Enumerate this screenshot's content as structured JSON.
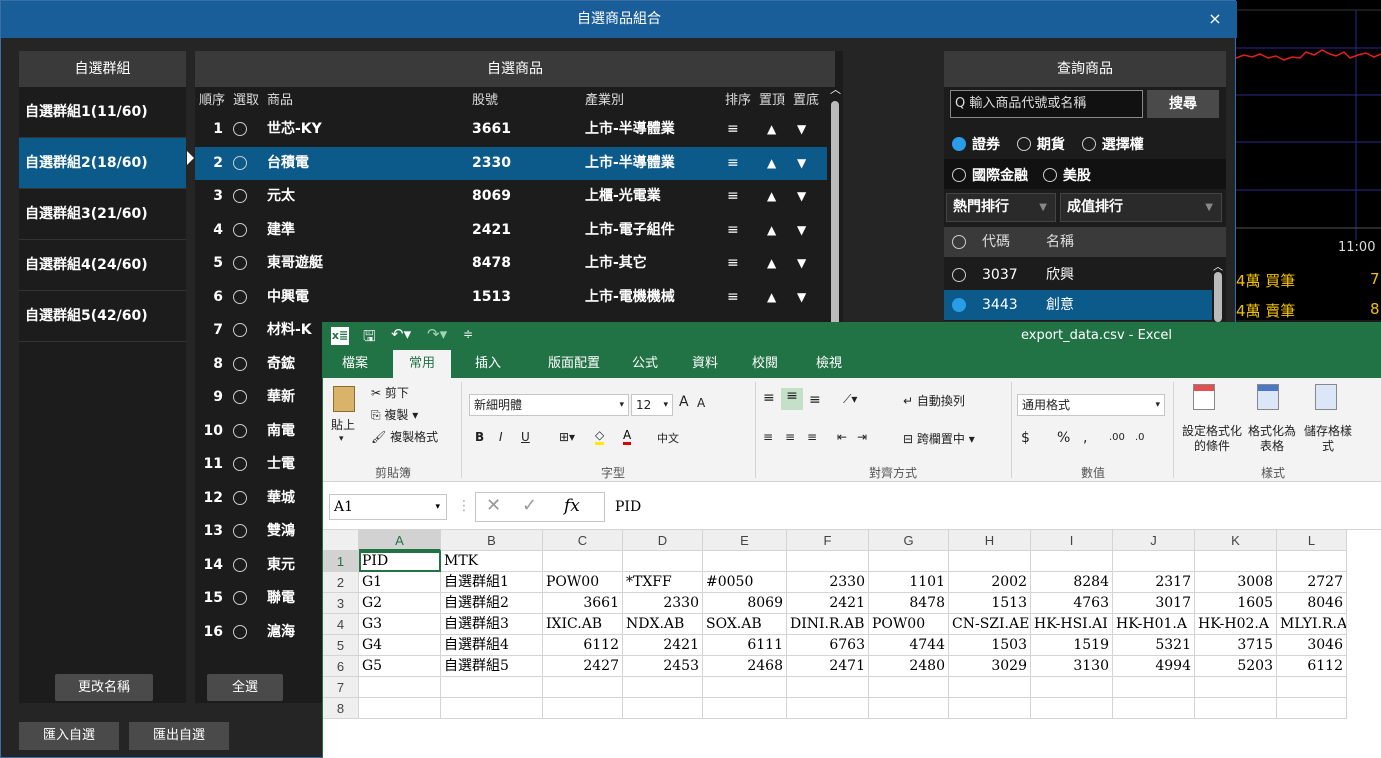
{
  "dialog": {
    "title": "自選商品組合",
    "close": "×"
  },
  "groups": {
    "header": "自選群組",
    "items": [
      "自選群組1(11/60)",
      "自選群組2(18/60)",
      "自選群組3(21/60)",
      "自選群組4(24/60)",
      "自選群組5(42/60)"
    ],
    "selected_index": 1,
    "rename_label": "更改名稱"
  },
  "products": {
    "header": "自選商品",
    "columns": {
      "order": "順序",
      "select": "選取",
      "name": "商品",
      "code": "股號",
      "industry": "產業別",
      "sort": "排序",
      "top": "置頂",
      "bottom": "置底"
    },
    "rows": [
      {
        "no": "1",
        "name": "世芯-KY",
        "code": "3661",
        "industry": "上市-半導體業"
      },
      {
        "no": "2",
        "name": "台積電",
        "code": "2330",
        "industry": "上市-半導體業"
      },
      {
        "no": "3",
        "name": "元太",
        "code": "8069",
        "industry": "上櫃-光電業"
      },
      {
        "no": "4",
        "name": "建準",
        "code": "2421",
        "industry": "上市-電子組件"
      },
      {
        "no": "5",
        "name": "東哥遊艇",
        "code": "8478",
        "industry": "上市-其它"
      },
      {
        "no": "6",
        "name": "中興電",
        "code": "1513",
        "industry": "上市-電機機械"
      },
      {
        "no": "7",
        "name": "材料-K",
        "code": "",
        "industry": ""
      },
      {
        "no": "8",
        "name": "奇鋐",
        "code": "",
        "industry": ""
      },
      {
        "no": "9",
        "name": "華新",
        "code": "",
        "industry": ""
      },
      {
        "no": "10",
        "name": "南電",
        "code": "",
        "industry": ""
      },
      {
        "no": "11",
        "name": "士電",
        "code": "",
        "industry": ""
      },
      {
        "no": "12",
        "name": "華城",
        "code": "",
        "industry": ""
      },
      {
        "no": "13",
        "name": "雙鴻",
        "code": "",
        "industry": ""
      },
      {
        "no": "14",
        "name": "東元",
        "code": "",
        "industry": ""
      },
      {
        "no": "15",
        "name": "聯電",
        "code": "",
        "industry": ""
      },
      {
        "no": "16",
        "name": "滬海",
        "code": "",
        "industry": ""
      }
    ],
    "selected_index": 1,
    "icons": {
      "sort": "≡",
      "top": "▲",
      "bottom": "▼"
    },
    "select_all_label": "全選"
  },
  "footer": {
    "import_label": "匯入自選",
    "export_label": "匯出自選"
  },
  "query": {
    "header": "查詢商品",
    "search_placeholder": "輸入商品代號或名稱",
    "search_icon": "Q",
    "search_button": "搜尋",
    "markets": [
      "證券",
      "期貨",
      "選擇權",
      "國際金融",
      "美股"
    ],
    "market_selected": 0,
    "dropdown1": "熱門排行",
    "dropdown2": "成值排行",
    "list_headers": {
      "code": "代碼",
      "name": "名稱"
    },
    "list": [
      {
        "code": "3037",
        "name": "欣興"
      },
      {
        "code": "3443",
        "name": "創意"
      }
    ]
  },
  "chart_side": {
    "time": "11:00",
    "row1_label": "4萬 買筆",
    "row1_value": "7",
    "row2_label": "4萬 賣筆",
    "row2_value": "8"
  },
  "excel": {
    "title": "export_data.csv - Excel",
    "qat_logo": "x≣",
    "tabs": [
      "檔案",
      "常用",
      "插入",
      "版面配置",
      "公式",
      "資料",
      "校閱",
      "檢視"
    ],
    "active_tab": 1,
    "clipboard": {
      "paste": "貼上",
      "cut": "剪下",
      "copy": "複製",
      "format_painter": "複製格式",
      "label": "剪貼簿"
    },
    "font": {
      "name": "新細明體",
      "size": "12",
      "label": "字型",
      "bold": "B",
      "italic": "I",
      "underline": "U",
      "grow": "A",
      "shrink": "A",
      "phonetic": "中文"
    },
    "alignment": {
      "wrap": "自動換列",
      "merge": "跨欄置中",
      "label": "對齊方式"
    },
    "number": {
      "format": "通用格式",
      "currency": "$",
      "percent": "%",
      "comma": ",",
      "inc_dec": ".00",
      "dec_dec": ".0",
      "label": "數值"
    },
    "styles": {
      "conditional": "設定格式化的條件",
      "as_table": "格式化為表格",
      "cell_styles": "儲存格樣式",
      "label": "樣式"
    },
    "name_box": "A1",
    "formula": "PID",
    "fx": "fx",
    "columns": [
      "A",
      "B",
      "C",
      "D",
      "E",
      "F",
      "G",
      "H",
      "I",
      "J",
      "K",
      "L"
    ],
    "rows": [
      [
        "PID",
        "MTK",
        "",
        "",
        "",
        "",
        "",
        "",
        "",
        "",
        "",
        ""
      ],
      [
        "G1",
        "自選群組1",
        "POW00",
        "*TXFF",
        "#0050",
        "2330",
        "1101",
        "2002",
        "8284",
        "2317",
        "3008",
        "2727"
      ],
      [
        "G2",
        "自選群組2",
        "3661",
        "2330",
        "8069",
        "2421",
        "8478",
        "1513",
        "4763",
        "3017",
        "1605",
        "8046"
      ],
      [
        "G3",
        "自選群組3",
        "IXIC.AB",
        "NDX.AB",
        "SOX.AB",
        "DINI.R.AB",
        "POW00",
        "CN-SZI.AE",
        "HK-HSI.AI",
        "HK-H01.A",
        "HK-H02.A",
        "MLYI.R.A"
      ],
      [
        "G4",
        "自選群組4",
        "6112",
        "2421",
        "6111",
        "6763",
        "4744",
        "1503",
        "1519",
        "5321",
        "3715",
        "3046"
      ],
      [
        "G5",
        "自選群組5",
        "2427",
        "2453",
        "2468",
        "2471",
        "2480",
        "3029",
        "3130",
        "4994",
        "5203",
        "6112"
      ],
      [
        "",
        "",
        "",
        "",
        "",
        "",
        "",
        "",
        "",
        "",
        "",
        ""
      ],
      [
        "",
        "",
        "",
        "",
        "",
        "",
        "",
        "",
        "",
        "",
        "",
        ""
      ]
    ],
    "row_numbers": [
      "1",
      "2",
      "3",
      "4",
      "5",
      "6",
      "7",
      "8"
    ]
  }
}
